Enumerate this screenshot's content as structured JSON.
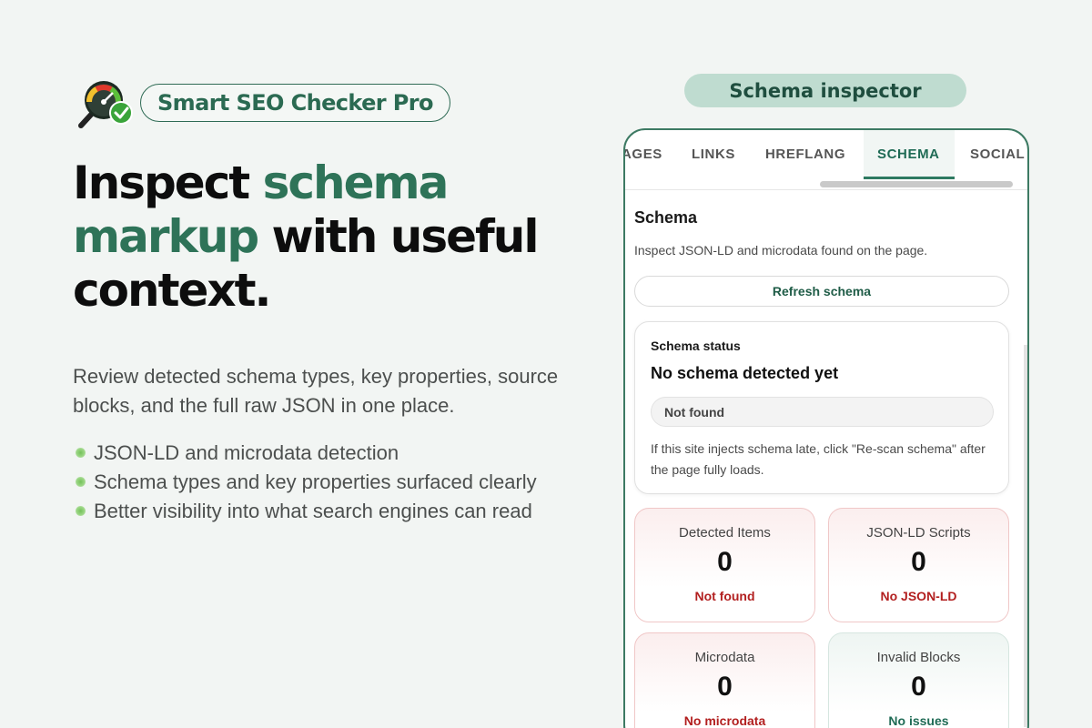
{
  "brand": {
    "name": "Smart SEO Checker Pro",
    "icon": "magnifier-gauge-check-icon"
  },
  "headline": {
    "part1": "Inspect ",
    "accent": "schema markup",
    "part2": " with useful context."
  },
  "lead": "Review detected schema types, key properties, source blocks, and the full raw JSON in one place.",
  "bullets": [
    "JSON-LD and microdata detection",
    "Schema types and key properties surfaced clearly",
    "Better visibility into what search engines can read"
  ],
  "caption": "Schema inspector",
  "tabs": [
    {
      "label": "AGES",
      "active": false
    },
    {
      "label": "LINKS",
      "active": false
    },
    {
      "label": "HREFLANG",
      "active": false
    },
    {
      "label": "SCHEMA",
      "active": true
    },
    {
      "label": "SOCIAL",
      "active": false
    }
  ],
  "panel": {
    "title": "Schema",
    "subtitle": "Inspect JSON-LD and microdata found on the page.",
    "refresh_label": "Refresh schema"
  },
  "status": {
    "label": "Schema status",
    "heading": "No schema detected yet",
    "badge": "Not found",
    "note": "If this site injects schema late, click \"Re-scan schema\" after the page fully loads."
  },
  "stats": [
    {
      "label": "Detected Items",
      "value": "0",
      "note": "Not found"
    },
    {
      "label": "JSON-LD Scripts",
      "value": "0",
      "note": "No JSON-LD"
    },
    {
      "label": "Microdata",
      "value": "0",
      "note": "No microdata"
    },
    {
      "label": "Invalid Blocks",
      "value": "0",
      "note": "No issues"
    }
  ],
  "colors": {
    "accent": "#2e7358",
    "caption_bg": "#bfdcd0",
    "error_text": "#b21f1f",
    "ok_text": "#1f6b55"
  }
}
